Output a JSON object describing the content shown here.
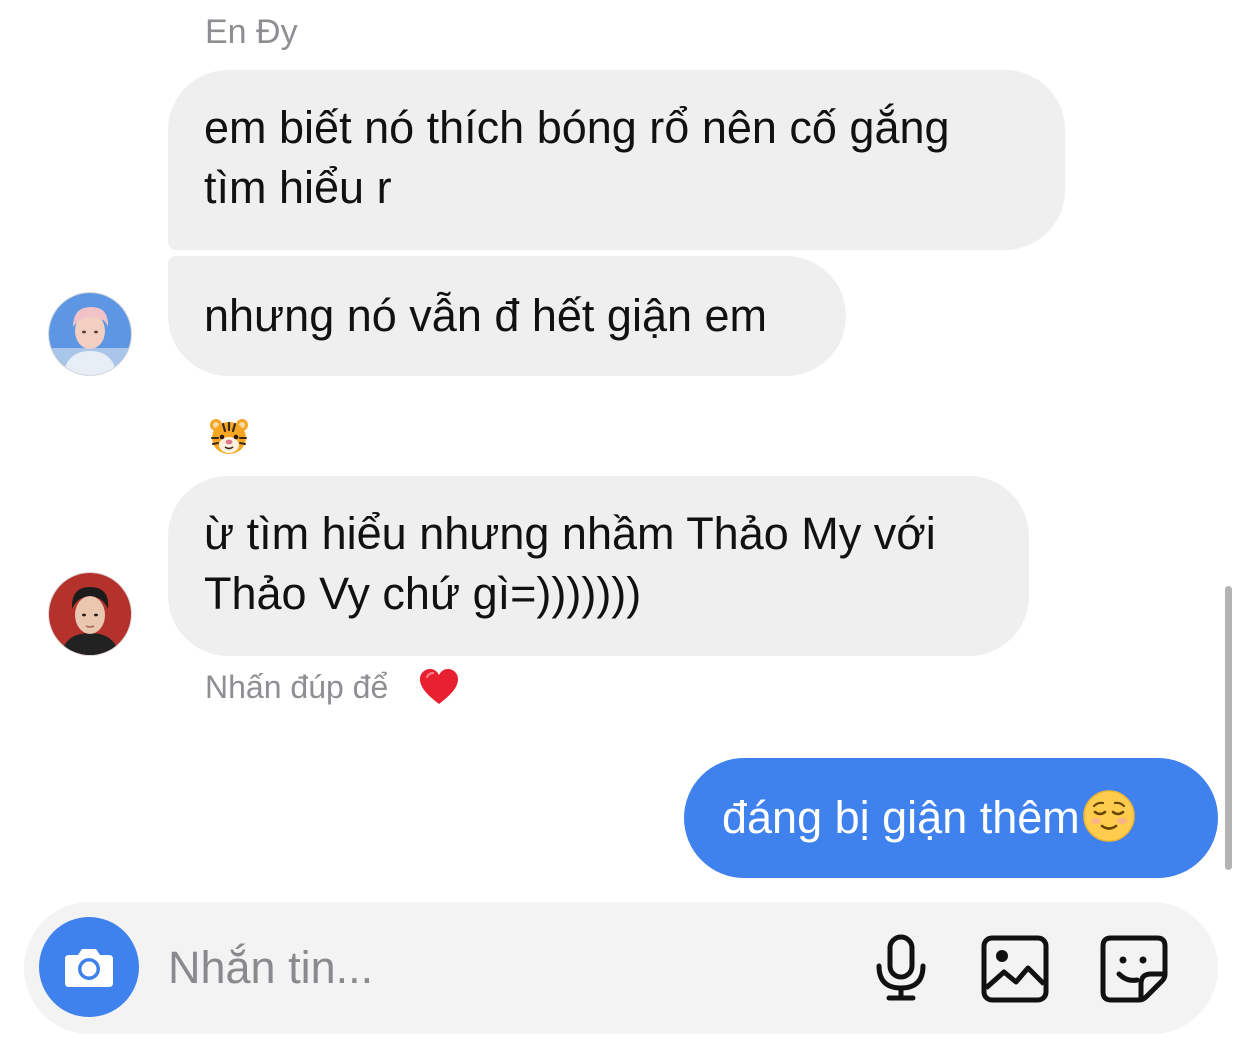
{
  "thread": {
    "sender_name": "En Đy",
    "messages": [
      {
        "id": "m1",
        "direction": "incoming",
        "lines": [
          "em biết nó thích bóng rổ nên cố gắng",
          "tìm hiểu r"
        ]
      },
      {
        "id": "m2",
        "direction": "incoming",
        "lines": [
          "nhưng nó vẫn đ hết giận em"
        ]
      },
      {
        "id": "m3",
        "direction": "incoming",
        "lines": [
          "ừ tìm hiểu nhưng nhầm Thảo My với",
          "Thảo Vy chứ gì=)))))))"
        ]
      },
      {
        "id": "m4",
        "direction": "outgoing",
        "text": "đáng bị giận thêm",
        "emoji": "relieved-face-emoji"
      }
    ],
    "reaction_emoji": "tiger-face-emoji",
    "double_tap_hint": "Nhấn đúp để",
    "hint_emoji": "red-heart-emoji"
  },
  "composer": {
    "placeholder": "Nhắn tin...",
    "value": "",
    "icons": [
      "camera-icon",
      "microphone-icon",
      "gallery-icon",
      "sticker-icon"
    ]
  },
  "colors": {
    "incoming_bubble": "#efefef",
    "outgoing_bubble": "#3f82ee",
    "muted_text": "#8e8e93",
    "composer_background": "#f3f3f3"
  }
}
